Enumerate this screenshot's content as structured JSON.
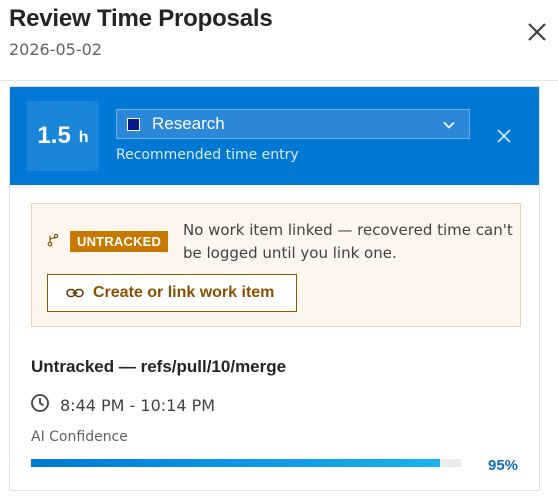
{
  "header": {
    "title": "Review Time Proposals",
    "date": "2026-05-02"
  },
  "proposal": {
    "hours_value": "1.5",
    "hours_unit": "h",
    "category": "Research",
    "category_color": "#0a1a8c",
    "recommended_label": "Recommended time entry",
    "warning": {
      "badge": "UNTRACKED",
      "message": "No work item linked — recovered time can't be logged until you link one.",
      "button_label": "Create or link work item"
    },
    "item_title": "Untracked — refs/pull/10/merge",
    "time_range": "8:44 PM - 10:14 PM",
    "confidence_label": "AI Confidence",
    "confidence_text": "95%",
    "confidence_fraction": 0.95
  },
  "colors": {
    "accent": "#0078d4",
    "warning_badge": "#c77800",
    "warning_bg": "#fdf6ee"
  },
  "icons": {
    "close": "close-icon",
    "dismiss": "dismiss-icon",
    "chevron": "chevron-down-icon",
    "branch": "branch-icon",
    "link": "link-icon",
    "clock": "clock-icon"
  }
}
